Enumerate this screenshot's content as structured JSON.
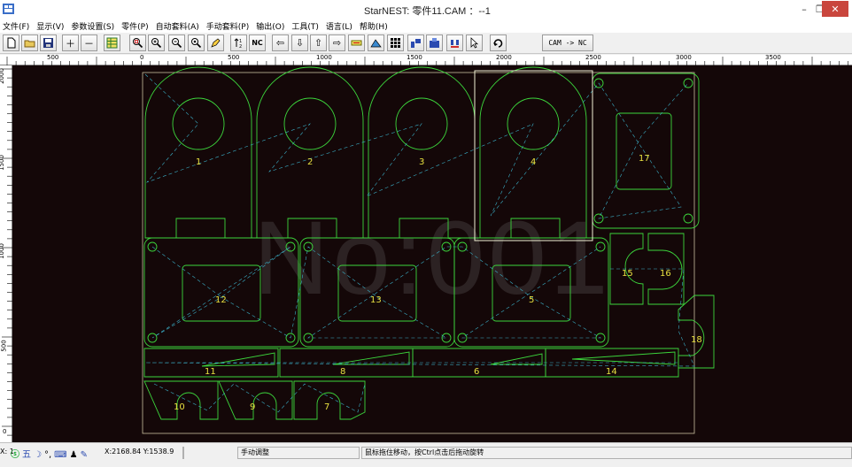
{
  "window": {
    "title": "StarNEST: 零件11.CAM ：--1"
  },
  "menu": [
    "文件(F)",
    "显示(V)",
    "参数设置(S)",
    "零件(P)",
    "自动套料(A)",
    "手动套料(P)",
    "输出(O)",
    "工具(T)",
    "语言(L)",
    "帮助(H)"
  ],
  "toolbar": {
    "nc_label": "NC",
    "cam_nc_label": "CAM -> NC"
  },
  "ruler": {
    "h_labels": [
      "500",
      "0",
      "500",
      "1000",
      "1500",
      "2000",
      "2500",
      "3000",
      "3500"
    ],
    "v_labels": [
      "2000",
      "1500",
      "1000",
      "500",
      "0"
    ]
  },
  "canvas": {
    "watermark": "No:001",
    "part_color": "#3cd63c",
    "plate_color": "#c8c0a0",
    "selection_color": "#f2f2d6",
    "parts": [
      {
        "id": "1"
      },
      {
        "id": "2"
      },
      {
        "id": "3"
      },
      {
        "id": "4"
      },
      {
        "id": "17"
      },
      {
        "id": "12"
      },
      {
        "id": "13"
      },
      {
        "id": "5"
      },
      {
        "id": "15"
      },
      {
        "id": "16"
      },
      {
        "id": "18"
      },
      {
        "id": "11"
      },
      {
        "id": "8"
      },
      {
        "id": "6"
      },
      {
        "id": "14"
      },
      {
        "id": "10"
      },
      {
        "id": "9"
      },
      {
        "id": "7"
      }
    ]
  },
  "status": {
    "coords_prefix": "X: 1",
    "coords": "X:2168.84 Y:1538.9",
    "mode": "手动调整",
    "hint": "鼠标拖住移动，按Ctrl点击后拖动旋转",
    "ime_label": "五"
  }
}
